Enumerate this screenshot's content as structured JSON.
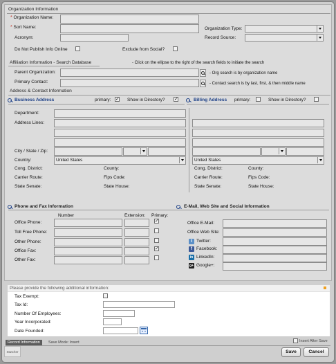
{
  "org": {
    "section_title": "Organization Information",
    "req_mark": "*",
    "name_label": "Organization Name:",
    "sort_label": "Sort Name:",
    "acronym_label": "Acronym:",
    "type_label": "Organization Type:",
    "source_label": "Record Source:",
    "donotpublish_label": "Do Not Publish Info Online",
    "exclude_social_label": "Exclude from Social?"
  },
  "affiliation": {
    "section_title": "Affiliation Information - Search Database",
    "hint": "- Click on the ellipse to the right of the search fields to initiate the search",
    "parent_label": "Parent Organization:",
    "parent_hint": "- Org search is by organization name",
    "primary_label": "Primary Contact:",
    "primary_hint": "- Contact search is by last, first, & then middle name"
  },
  "address": {
    "section_title": "Address & Contact Information",
    "business_title": "Business Address",
    "billing_title": "Billing Address",
    "primary_label": "primary:",
    "show_dir_label": "Show in Directory?",
    "business_primary": "✓",
    "business_show": "✓",
    "billing_primary": "",
    "billing_show": "",
    "department_label": "Department:",
    "lines_label": "Address Lines:",
    "city_label": "City / State / Zip:",
    "country_label": "Country:",
    "country_value": "United States",
    "billing_country_value": "United States",
    "cong_label": "Cong. District:",
    "county_label": "County:",
    "carrier_label": "Carrier Route:",
    "fips_label": "Fips Code:",
    "senate_label": "State Senate:",
    "house_label": "State House:"
  },
  "phone": {
    "section_title": "Phone and Fax Information",
    "col_number": "Number",
    "col_extension": "Extension:",
    "col_primary": "Primary:",
    "rows": [
      {
        "label": "Office Phone:",
        "primary": "✓"
      },
      {
        "label": "Toll Free Phone:",
        "primary": ""
      },
      {
        "label": "Other Phone:",
        "primary": ""
      },
      {
        "label": "Office Fax:",
        "primary": "✓"
      },
      {
        "label": "Other Fax:",
        "primary": ""
      }
    ]
  },
  "web": {
    "section_title": "E-Mail, Web Site and Social Information",
    "email_label": "Office E-Mail:",
    "website_label": "Office Web Site:",
    "twitter_label": "Twitter:",
    "facebook_label": "Facebook:",
    "linkedin_label": "LinkedIn:",
    "google_label": "Google+:",
    "twitter_glyph": "t",
    "facebook_glyph": "f",
    "linkedin_glyph": "in",
    "google_glyph": "g+"
  },
  "additional": {
    "title": "Please provide the following additional information:",
    "tax_exempt_label": "Tax Exempt:",
    "tax_id_label": "Tax Id:",
    "employees_label": "Number Of Employees:",
    "year_label": "Year Incorporated:",
    "founded_label": "Date Founded:"
  },
  "footer": {
    "record_tab": "Record Information",
    "save_mode": "Save Mode: Insert",
    "insert_after_save": "Insert After Save",
    "sticky_label": "Stutcher",
    "save_button": "Save",
    "cancel_button": "Cancel"
  }
}
